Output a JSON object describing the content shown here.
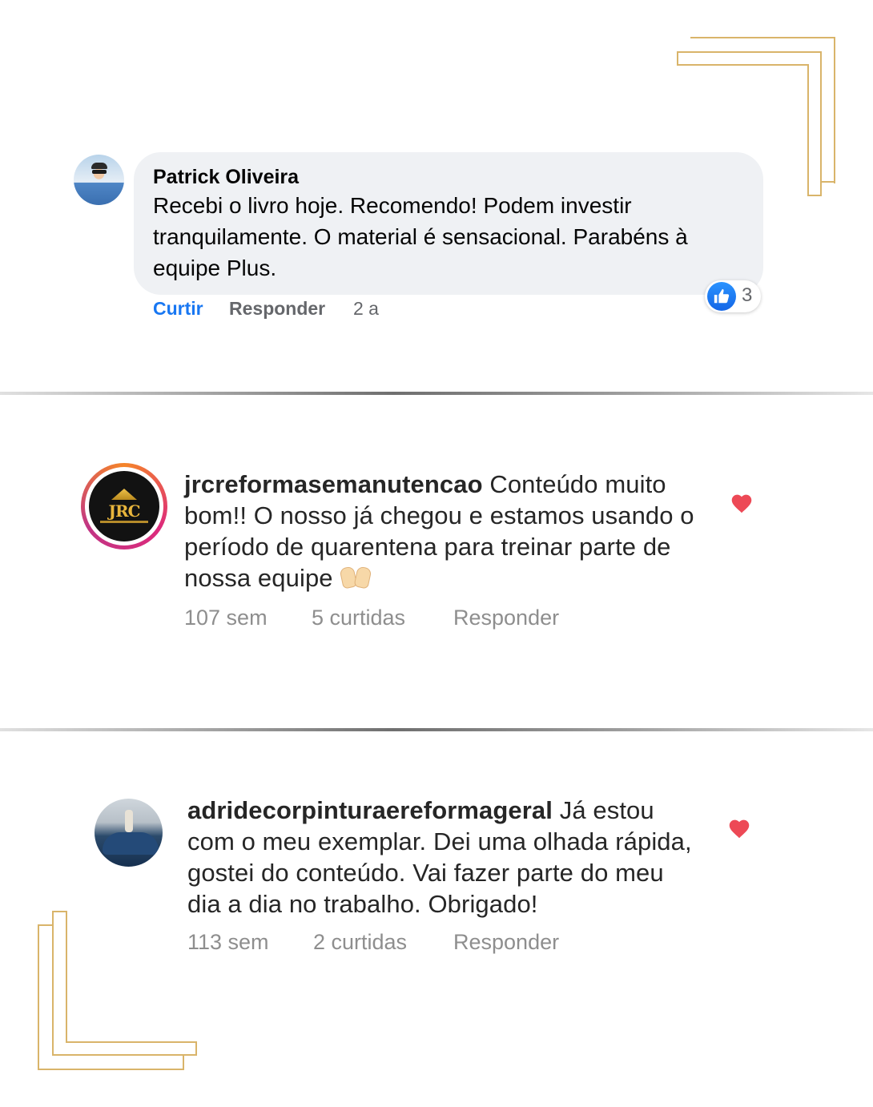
{
  "facebook_comment": {
    "author": "Patrick Oliveira",
    "text": "Recebi o livro hoje. Recomendo! Podem investir tranquilamente. O material é sensacional. Parabéns à equipe Plus.",
    "like_label": "Curtir",
    "reply_label": "Responder",
    "time": "2 a",
    "reaction_count": "3",
    "reaction_icon": "thumbs-up-icon"
  },
  "instagram_comments": [
    {
      "username": "jrcreformasemanutencao",
      "text": "Conteúdo muito bom!! O nosso já chegou e estamos usando o período de quarentena para treinar parte de nossa equipe",
      "emoji": "raised-hands-emoji",
      "time": "107 sem",
      "likes": "5 curtidas",
      "reply_label": "Responder",
      "avatar_text": "JRC",
      "liked": true
    },
    {
      "username": "adridecorpinturaereformageral",
      "text": "Já estou com o meu exemplar. Dei uma olhada rápida, gostei do conteúdo. Vai fazer parte do meu dia a dia no trabalho. Obrigado!",
      "time": "113 sem",
      "likes": "2 curtidas",
      "reply_label": "Responder",
      "liked": true
    }
  ],
  "colors": {
    "gold_frame": "#d9b46a",
    "facebook_blue": "#1877f2",
    "heart_red": "#ed4956",
    "bubble_bg": "#eff1f4"
  }
}
